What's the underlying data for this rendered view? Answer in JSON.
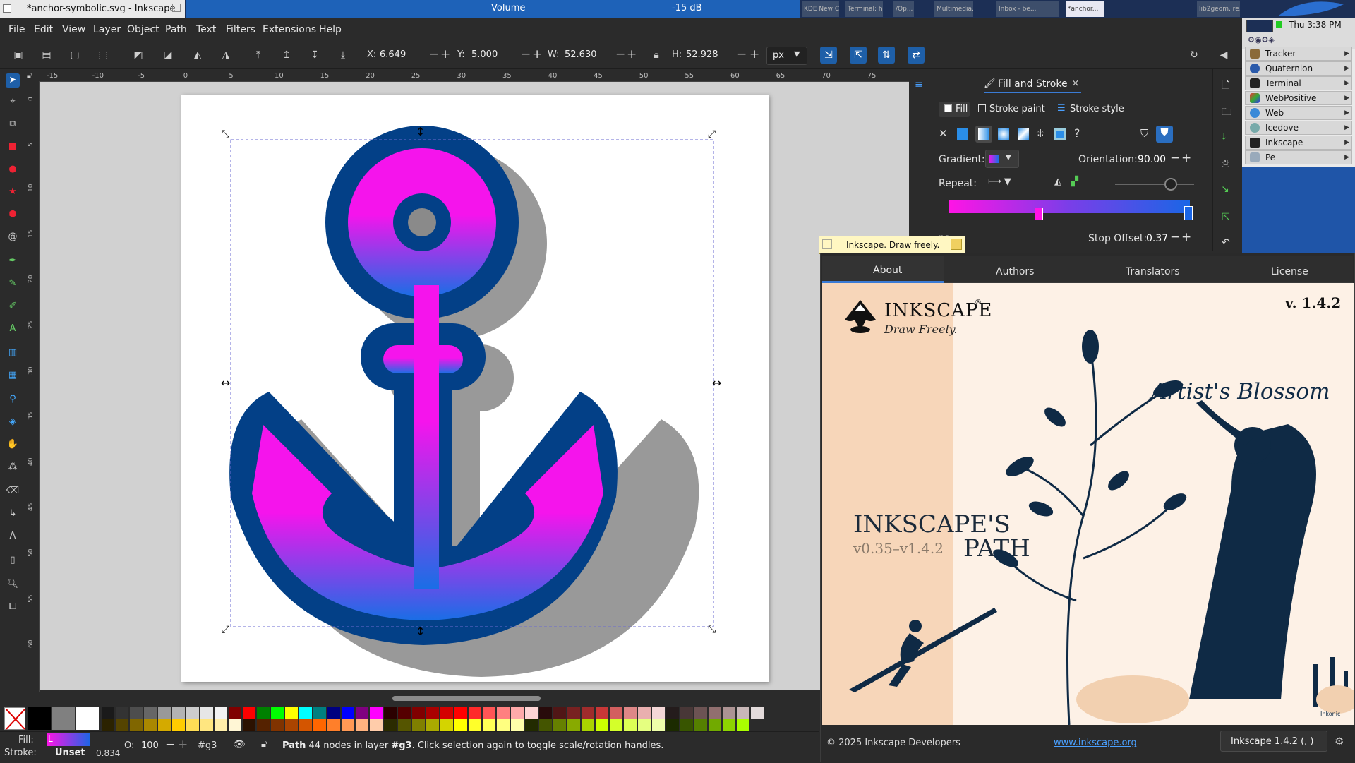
{
  "taskbar": {
    "window_title": "*anchor-symbolic.svg - Inkscape",
    "volume_label": "Volume",
    "volume_value": "-15 dB",
    "tasks": [
      "KDE New C...",
      "Terminal: h...",
      "/Op...",
      "Multimedia...",
      "Inbox - be...",
      "*anchor...",
      "lib2geom, re..."
    ]
  },
  "menubar": {
    "items": [
      "File",
      "Edit",
      "View",
      "Layer",
      "Object",
      "Path",
      "Text",
      "Filters",
      "Extensions",
      "Help"
    ]
  },
  "toolbar": {
    "x_label": "X:",
    "x_value": "6.649",
    "y_label": "Y:",
    "y_value": "5.000",
    "w_label": "W:",
    "w_value": "52.630",
    "h_label": "H:",
    "h_value": "52.928",
    "unit": "px"
  },
  "rulers": {
    "h_ticks": [
      "-15",
      "-10",
      "-5",
      "0",
      "5",
      "10",
      "15",
      "20",
      "25",
      "30",
      "35",
      "40",
      "45",
      "50",
      "55",
      "60",
      "65",
      "70",
      "75"
    ],
    "v_ticks": [
      "0",
      "5",
      "10",
      "15",
      "20",
      "25",
      "30",
      "35",
      "40",
      "45",
      "50",
      "55",
      "60"
    ]
  },
  "fill_stroke": {
    "tab_title": "Fill and Stroke",
    "tab_fill": "Fill",
    "tab_stroke_paint": "Stroke paint",
    "tab_stroke_style": "Stroke style",
    "question_mark": "?",
    "gradient_label": "Gradient:",
    "orientation_label": "Orientation:",
    "orientation_value": "90.00",
    "repeat_label": "Repeat:",
    "stops_partial": "ps",
    "stop_offset_label": "Stop Offset:",
    "stop_offset_value": "0.37",
    "gradient_start": "#ff14e6",
    "gradient_end": "#1a66e6"
  },
  "notification": {
    "text": "Inkscape. Draw freely."
  },
  "about": {
    "tabs": [
      "About",
      "Authors",
      "Translators",
      "License"
    ],
    "logo_title": "INKSCAPE",
    "logo_reg": "®",
    "tagline": "Draw Freely.",
    "version": "v. 1.4.2",
    "artwork_title": "Artist's Blossom",
    "path_title": "INKSCAPE'S",
    "path_word": "PATH",
    "path_range": "v0.35–v1.4.2",
    "signature": "Inkonic",
    "copyright": "© 2025 Inkscape Developers",
    "website": "www.inkscape.org",
    "version_button": "Inkscape 1.4.2 (, )"
  },
  "side_panel": {
    "clock": "Thu 3:38 PM",
    "items": [
      "Tracker",
      "Quaternion",
      "Terminal",
      "WebPositive",
      "Web",
      "Icedove",
      "Inkscape",
      "Pe"
    ]
  },
  "status": {
    "fill_label": "Fill:",
    "fill_short": "L",
    "stroke_label": "Stroke:",
    "stroke_value": "Unset",
    "stroke_width": "0.834",
    "opacity_label": "O:",
    "opacity_value": "100",
    "layer": "#g3",
    "message_bold": "Path",
    "message_a": " 44 nodes in layer ",
    "message_layer": "#g3",
    "message_b": ". Click selection again to toggle scale/rotation handles."
  },
  "palette_colors": [
    "#000000",
    "#808080",
    "#ffffff",
    "#1a1a1a",
    "#333333",
    "#4d4d4d",
    "#666666",
    "#999999",
    "#b3b3b3",
    "#cccccc",
    "#e6e6e6",
    "#f2f2f2",
    "#800000",
    "#ff0000",
    "#008000",
    "#00ff00",
    "#ffff00",
    "#00ffff",
    "#008080",
    "#000080",
    "#0000ff",
    "#800080",
    "#ff00ff",
    "#2b0000",
    "#550000",
    "#800000",
    "#aa0000",
    "#d40000",
    "#ff0000",
    "#ff2a2a",
    "#ff5555",
    "#ff8080",
    "#ffaaaa",
    "#ffd5d5",
    "#280b0b",
    "#501616",
    "#782121",
    "#a02c2c",
    "#c83737",
    "#d35f5f",
    "#de8787",
    "#e9afaf",
    "#f4d7d7",
    "#241c1c",
    "#483737",
    "#6c5353",
    "#916f6f",
    "#ac9393",
    "#c8b7b7",
    "#e3dbdb"
  ],
  "palette_colors_row2": [
    "#2b2200",
    "#554400",
    "#806600",
    "#aa8800",
    "#d4aa00",
    "#ffcc00",
    "#ffdd55",
    "#ffe680",
    "#ffeeaa",
    "#fff6d5",
    "#2b1100",
    "#552200",
    "#803300",
    "#aa4400",
    "#d45500",
    "#ff6600",
    "#ff7f2a",
    "#ff9955",
    "#ffb380",
    "#ffccaa",
    "#2b2b00",
    "#555500",
    "#808000",
    "#aaaa00",
    "#d4d400",
    "#ffff00",
    "#ffff2a",
    "#ffff55",
    "#ffff80",
    "#ffffaa",
    "#222b00",
    "#445500",
    "#668000",
    "#88aa00",
    "#aad400",
    "#ccff00",
    "#d4ff2a",
    "#ddff55",
    "#e5ff80",
    "#eeffaa",
    "#1c2b00",
    "#385500",
    "#558000",
    "#71aa00",
    "#8dd400",
    "#aaff00"
  ]
}
